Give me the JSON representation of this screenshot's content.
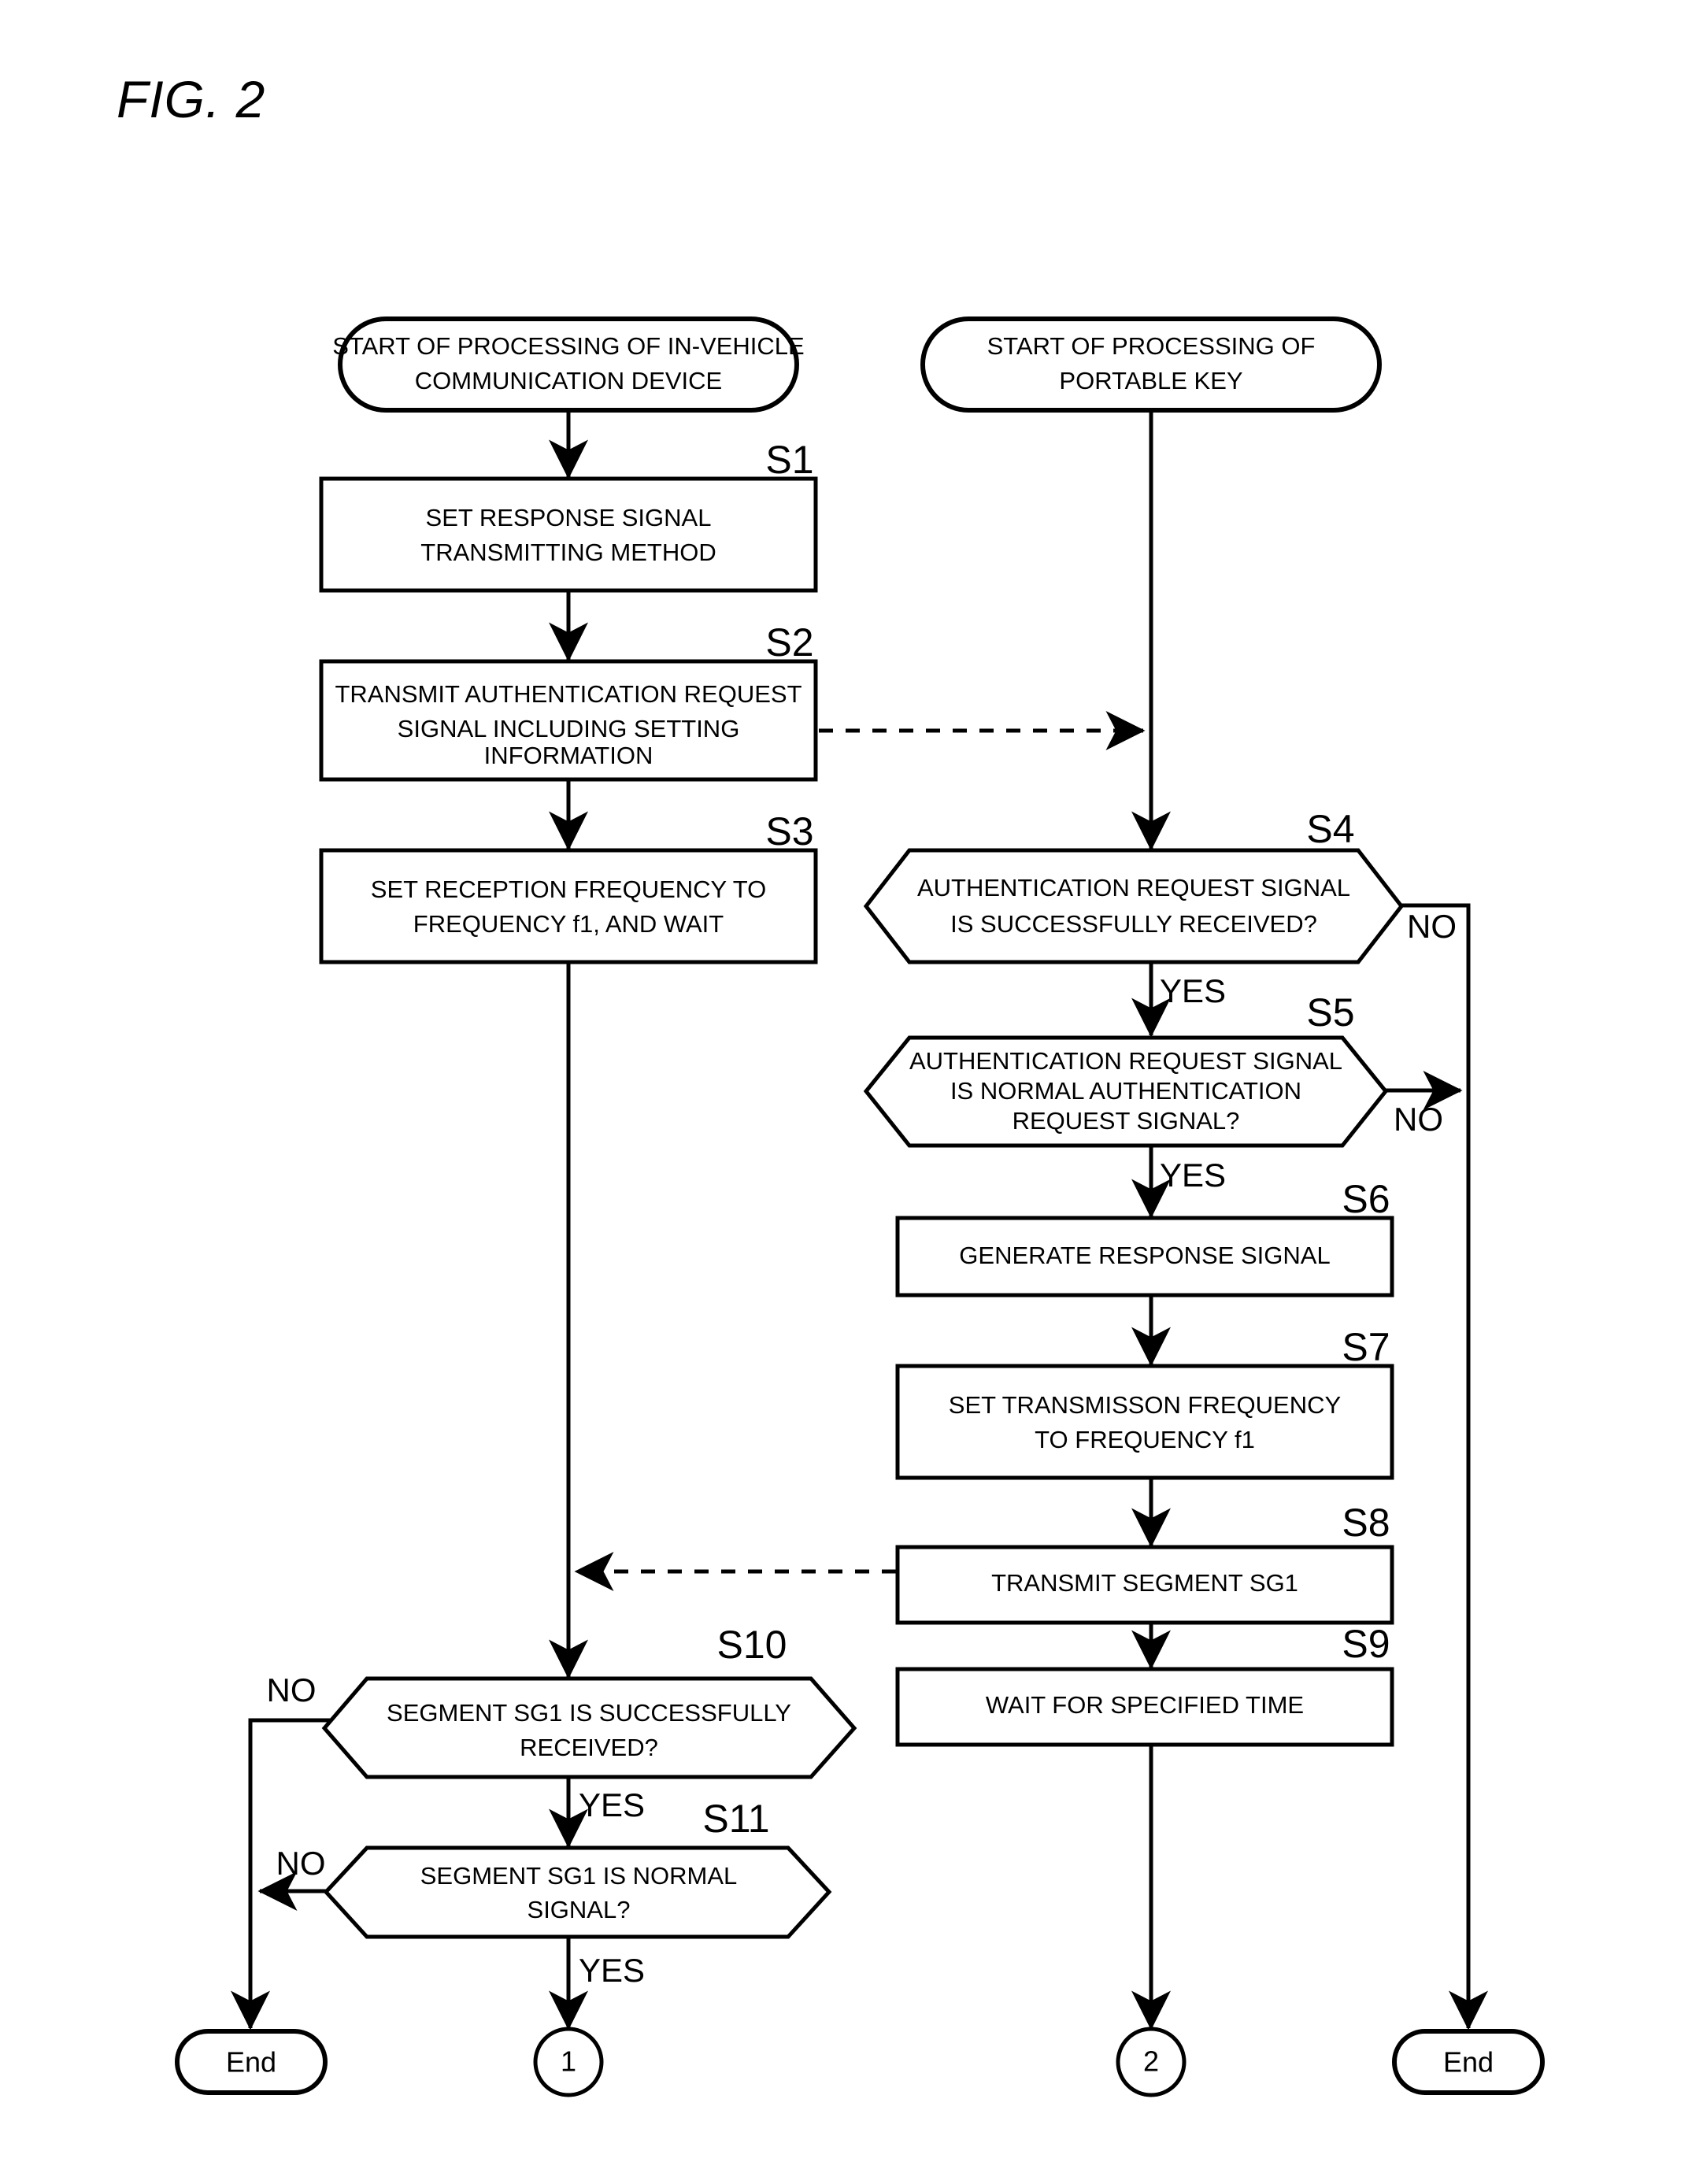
{
  "figure": {
    "title": "FIG. 2"
  },
  "flowchart": {
    "columns": {
      "left": {
        "name": "in-vehicle-communication-device"
      },
      "right": {
        "name": "portable-key"
      }
    },
    "terminals": {
      "start_left": "START OF PROCESSING OF IN-VEHICLE COMMUNICATION DEVICE",
      "start_left_line1": "START OF PROCESSING OF IN-VEHICLE",
      "start_left_line2": "COMMUNICATION DEVICE",
      "start_right_line1": "START OF PROCESSING OF",
      "start_right_line2": "PORTABLE KEY",
      "end_left": "End",
      "end_right": "End",
      "connector_one": "1",
      "connector_two": "2"
    },
    "steps": [
      {
        "id": "S1",
        "label": "S1",
        "shape": "process",
        "lines": [
          "SET RESPONSE SIGNAL",
          "TRANSMITTING METHOD"
        ]
      },
      {
        "id": "S2",
        "label": "S2",
        "shape": "process",
        "lines": [
          "TRANSMIT AUTHENTICATION REQUEST",
          "SIGNAL INCLUDING SETTING",
          "INFORMATION"
        ]
      },
      {
        "id": "S3",
        "label": "S3",
        "shape": "process",
        "lines": [
          "SET RECEPTION FREQUENCY TO",
          "FREQUENCY f1, AND WAIT"
        ]
      },
      {
        "id": "S4",
        "label": "S4",
        "shape": "decision",
        "lines": [
          "AUTHENTICATION REQUEST SIGNAL",
          "IS SUCCESSFULLY RECEIVED?"
        ]
      },
      {
        "id": "S5",
        "label": "S5",
        "shape": "decision",
        "lines": [
          "AUTHENTICATION REQUEST SIGNAL",
          "IS NORMAL AUTHENTICATION",
          "REQUEST SIGNAL?"
        ]
      },
      {
        "id": "S6",
        "label": "S6",
        "shape": "process",
        "lines": [
          "GENERATE RESPONSE SIGNAL"
        ]
      },
      {
        "id": "S7",
        "label": "S7",
        "shape": "process",
        "lines": [
          "SET TRANSMISSON FREQUENCY",
          "TO FREQUENCY f1"
        ]
      },
      {
        "id": "S8",
        "label": "S8",
        "shape": "process",
        "lines": [
          "TRANSMIT SEGMENT SG1"
        ]
      },
      {
        "id": "S9",
        "label": "S9",
        "shape": "process",
        "lines": [
          "WAIT FOR SPECIFIED TIME"
        ]
      },
      {
        "id": "S10",
        "label": "S10",
        "shape": "decision",
        "lines": [
          "SEGMENT SG1 IS SUCCESSFULLY",
          "RECEIVED?"
        ]
      },
      {
        "id": "S11",
        "label": "S11",
        "shape": "decision",
        "lines": [
          "SEGMENT SG1 IS NORMAL",
          "SIGNAL?"
        ]
      }
    ],
    "branch_labels": {
      "s4_no": "NO",
      "s4_yes": "YES",
      "s5_no": "NO",
      "s5_yes": "YES",
      "s10_no": "NO",
      "s10_yes": "YES",
      "s11_no": "NO",
      "s11_yes": "YES"
    },
    "colors": {
      "stroke": "#000000",
      "fill": "#ffffff"
    }
  }
}
